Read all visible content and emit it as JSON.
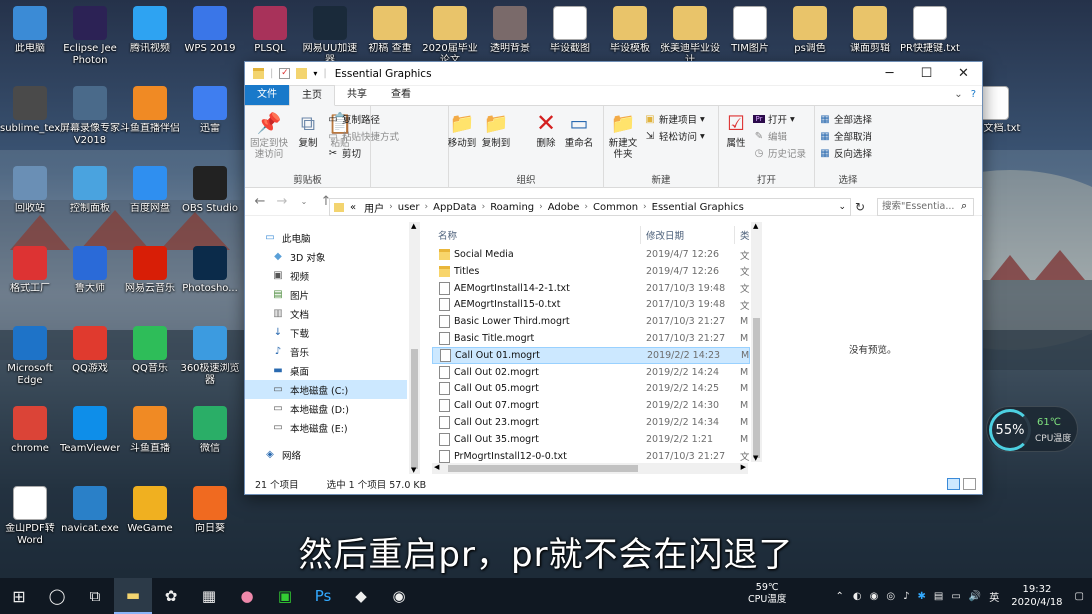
{
  "desktop_icons": [
    {
      "label": "此电脑",
      "icon": "pc-icon",
      "color": "#3b8bd6"
    },
    {
      "label": "Eclipse Jee Photon",
      "icon": "eclipse-icon",
      "color": "#2c2255"
    },
    {
      "label": "腾讯视频",
      "icon": "tencent-video-icon",
      "color": "#2ea3f2"
    },
    {
      "label": "WPS 2019",
      "icon": "wps-icon",
      "color": "#3a76e8"
    },
    {
      "label": "PLSQL",
      "icon": "plsql-icon",
      "color": "#a8325a"
    },
    {
      "label": "网易UU加速器",
      "icon": "uu-icon",
      "color": "#1a2a3a"
    },
    {
      "label": "初稿 查重",
      "icon": "folder-icon",
      "color": "#e9c46a"
    },
    {
      "label": "2020届毕业论文",
      "icon": "folder-icon",
      "color": "#e9c46a"
    },
    {
      "label": "透明背景",
      "icon": "zip-icon",
      "color": "#7a6a6a"
    },
    {
      "label": "毕设截图",
      "icon": "word-icon",
      "color": "#ffffff"
    },
    {
      "label": "毕设模板",
      "icon": "folder-icon",
      "color": "#e9c46a"
    },
    {
      "label": "张美迪毕业设计",
      "icon": "folder-icon",
      "color": "#e9c46a"
    },
    {
      "label": "TIM图片",
      "icon": "image-icon",
      "color": "#ffffff"
    },
    {
      "label": "ps调色",
      "icon": "folder-icon",
      "color": "#e9c46a"
    },
    {
      "label": "课面剪辑",
      "icon": "folder-icon",
      "color": "#e9c46a"
    },
    {
      "label": "PR快捷键.txt",
      "icon": "txt-icon",
      "color": "#ffffff"
    },
    {
      "label": "sublime_text",
      "icon": "sublime-icon",
      "color": "#4a4a4a"
    },
    {
      "label": "屏幕录像专家V2018",
      "icon": "recorder-icon",
      "color": "#4a6a8a"
    },
    {
      "label": "斗鱼直播伴侣",
      "icon": "douyu-icon",
      "color": "#f08a24"
    },
    {
      "label": "迅雷",
      "icon": "thunder-icon",
      "color": "#3f7ef0"
    },
    {
      "label": "回收站",
      "icon": "recycle-bin-icon",
      "color": "#6a8fb5"
    },
    {
      "label": "控制面板",
      "icon": "control-panel-icon",
      "color": "#4aa3df"
    },
    {
      "label": "百度网盘",
      "icon": "baidu-disk-icon",
      "color": "#2f8ff0"
    },
    {
      "label": "OBS Studio",
      "icon": "obs-icon",
      "color": "#222222"
    },
    {
      "label": "格式工厂",
      "icon": "format-factory-icon",
      "color": "#d33"
    },
    {
      "label": "鲁大师",
      "icon": "ludashi-icon",
      "color": "#2a6ad8"
    },
    {
      "label": "网易云音乐",
      "icon": "netease-music-icon",
      "color": "#d81e06"
    },
    {
      "label": "Photosho...",
      "icon": "photoshop-icon",
      "color": "#0b2b4a"
    },
    {
      "label": "Microsoft Edge",
      "icon": "edge-icon",
      "color": "#1e73c8"
    },
    {
      "label": "QQ游戏",
      "icon": "qq-game-icon",
      "color": "#e03a2e"
    },
    {
      "label": "QQ音乐",
      "icon": "qq-music-icon",
      "color": "#2ebd59"
    },
    {
      "label": "360极速浏览器",
      "icon": "360-browser-icon",
      "color": "#3c9be0"
    },
    {
      "label": "chrome",
      "icon": "chrome-icon",
      "color": "#db4437"
    },
    {
      "label": "TeamViewer",
      "icon": "teamviewer-icon",
      "color": "#0e8ee9"
    },
    {
      "label": "斗鱼直播",
      "icon": "douyu-live-icon",
      "color": "#f08a24"
    },
    {
      "label": "微信",
      "icon": "wechat-icon",
      "color": "#2aae67"
    },
    {
      "label": "金山PDF转Word",
      "icon": "pdf-icon",
      "color": "#ffffff"
    },
    {
      "label": "navicat.exe",
      "icon": "navicat-icon",
      "color": "#2a80c8"
    },
    {
      "label": "WeGame",
      "icon": "wegame-icon",
      "color": "#f0b020"
    },
    {
      "label": "向日葵",
      "icon": "sunflower-icon",
      "color": "#f06a20"
    },
    {
      "label": "文本文档.txt",
      "icon": "txt-icon",
      "color": "#ffffff"
    }
  ],
  "window": {
    "title": "Essential Graphics",
    "min": "─",
    "max": "☐",
    "close": "✕",
    "tabs": [
      "文件",
      "主页",
      "共享",
      "查看"
    ],
    "ribbon": {
      "pin": "固定到快速访问",
      "copy": "复制",
      "paste": "粘贴",
      "copy_path": "复制路径",
      "paste_shortcut": "粘贴快捷方式",
      "cut": "剪切",
      "group_clipboard": "剪贴板",
      "move_to": "移动到",
      "copy_to": "复制到",
      "delete": "删除",
      "rename": "重命名",
      "group_organize": "组织",
      "new_folder": "新建文件夹",
      "new_item": "新建项目",
      "easy_access": "轻松访问",
      "group_new": "新建",
      "properties": "属性",
      "open": "打开",
      "edit": "编辑",
      "history": "历史记录",
      "group_open": "打开",
      "select_all": "全部选择",
      "select_none": "全部取消",
      "invert": "反向选择",
      "group_select": "选择"
    },
    "breadcrumb": [
      "«",
      "用户",
      "user",
      "AppData",
      "Roaming",
      "Adobe",
      "Common",
      "Essential Graphics"
    ],
    "search_placeholder": "搜索\"Essentia...",
    "nav": [
      "此电脑",
      "3D 对象",
      "视频",
      "图片",
      "文档",
      "下载",
      "音乐",
      "桌面",
      "本地磁盘 (C:)",
      "本地磁盘 (D:)",
      "本地磁盘 (E:)",
      "网络"
    ],
    "columns": {
      "name": "名称",
      "date": "修改日期",
      "type": "类"
    },
    "files": [
      {
        "name": "Social Media",
        "date": "2019/4/7 12:26",
        "type": "文",
        "kind": "folder"
      },
      {
        "name": "Titles",
        "date": "2019/4/7 12:26",
        "type": "文",
        "kind": "folder"
      },
      {
        "name": "AEMogrtInstall14-2-1.txt",
        "date": "2017/10/3 19:48",
        "type": "文",
        "kind": "doc"
      },
      {
        "name": "AEMogrtInstall15-0.txt",
        "date": "2017/10/3 19:48",
        "type": "文",
        "kind": "doc"
      },
      {
        "name": "Basic Lower Third.mogrt",
        "date": "2017/10/3 21:27",
        "type": "M",
        "kind": "doc"
      },
      {
        "name": "Basic Title.mogrt",
        "date": "2017/10/3 21:27",
        "type": "M",
        "kind": "doc"
      },
      {
        "name": "Call Out 01.mogrt",
        "date": "2019/2/2 14:23",
        "type": "M",
        "kind": "doc"
      },
      {
        "name": "Call Out 02.mogrt",
        "date": "2019/2/2 14:24",
        "type": "M",
        "kind": "doc"
      },
      {
        "name": "Call Out 05.mogrt",
        "date": "2019/2/2 14:25",
        "type": "M",
        "kind": "doc"
      },
      {
        "name": "Call Out 07.mogrt",
        "date": "2019/2/2 14:30",
        "type": "M",
        "kind": "doc"
      },
      {
        "name": "Call Out 23.mogrt",
        "date": "2019/2/2 14:34",
        "type": "M",
        "kind": "doc"
      },
      {
        "name": "Call Out 35.mogrt",
        "date": "2019/2/2 1:21",
        "type": "M",
        "kind": "doc"
      },
      {
        "name": "PrMogrtInstall12-0-0.txt",
        "date": "2017/10/3 21:27",
        "type": "文",
        "kind": "doc"
      }
    ],
    "preview": "没有预览。",
    "status": {
      "count": "21 个项目",
      "selected": "选中 1 个项目  57.0 KB"
    }
  },
  "cpu": {
    "percent": "55%",
    "temp": "61℃",
    "label": "CPU温度"
  },
  "subtitle": "然后重启pr，pr就不会在闪退了",
  "taskbar": {
    "cpu_temp": "59℃",
    "cpu_label": "CPU温度",
    "ime": "英",
    "time": "19:32",
    "date": "2020/4/18"
  }
}
